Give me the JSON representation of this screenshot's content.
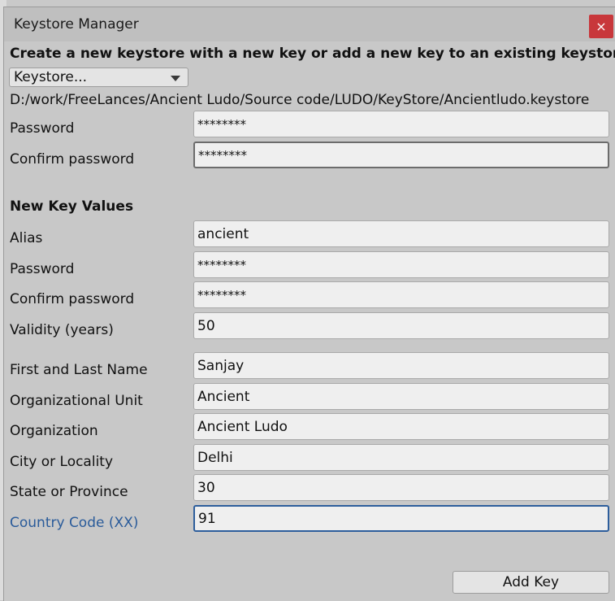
{
  "window": {
    "title": "Keystore Manager",
    "close_glyph": "×"
  },
  "header": {
    "instruction": "Create a new keystore with a new key or add a new key to an existing keystore",
    "keystore_dropdown": "Keystore...",
    "keystore_path": "D:/work/FreeLances/Ancient Ludo/Source code/LUDO/KeyStore/Ancientludo.keystore"
  },
  "keystore": {
    "password_label": "Password",
    "password_value": "********",
    "confirm_label": "Confirm password",
    "confirm_value": "********"
  },
  "new_key": {
    "section_title": "New Key Values",
    "alias_label": "Alias",
    "alias_value": "ancient",
    "password_label": "Password",
    "password_value": "********",
    "confirm_label": "Confirm password",
    "confirm_value": "********",
    "validity_label": "Validity (years)",
    "validity_value": "50",
    "name_label": "First and Last Name",
    "name_value": "Sanjay",
    "org_unit_label": "Organizational Unit",
    "org_unit_value": "Ancient",
    "org_label": "Organization",
    "org_value": "Ancient Ludo",
    "city_label": "City or Locality",
    "city_value": "Delhi",
    "state_label": "State or Province",
    "state_value": "30",
    "country_label": "Country Code (XX)",
    "country_value": "91"
  },
  "actions": {
    "add_key_label": "Add Key"
  },
  "colors": {
    "close_button": "#c8373b",
    "focus_accent": "#2d5e9c",
    "window_bg": "#c8c8c8"
  }
}
